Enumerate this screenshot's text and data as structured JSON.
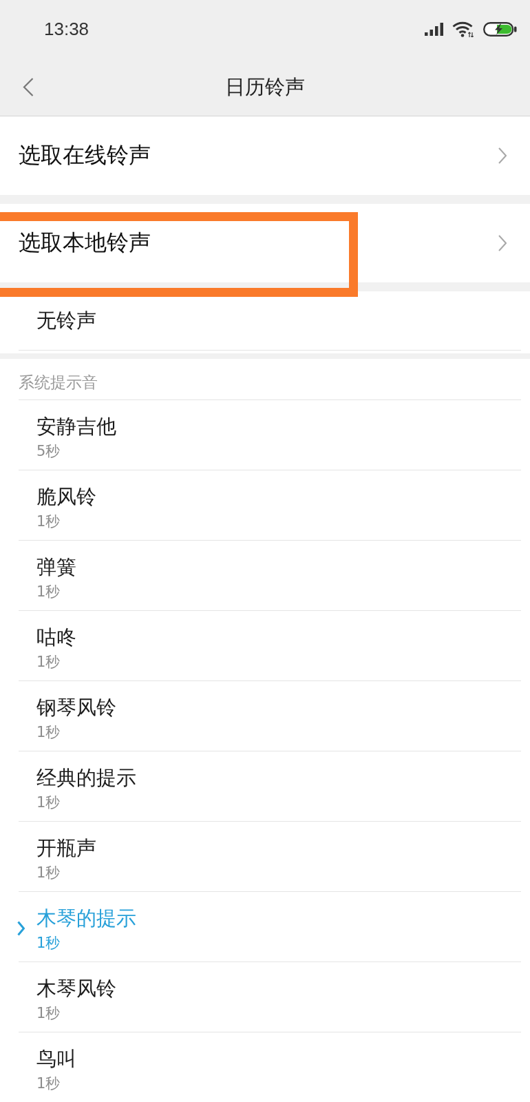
{
  "status_bar": {
    "time": "13:38"
  },
  "header": {
    "title": "日历铃声"
  },
  "links": [
    {
      "label": "选取在线铃声",
      "highlighted": false
    },
    {
      "label": "选取本地铃声",
      "highlighted": true
    }
  ],
  "no_ringtone": {
    "label": "无铃声",
    "selected": false
  },
  "system_sounds": {
    "title": "系统提示音",
    "items": [
      {
        "name": "安静吉他",
        "duration": "5秒",
        "selected": false
      },
      {
        "name": "脆风铃",
        "duration": "1秒",
        "selected": false
      },
      {
        "name": "弹簧",
        "duration": "1秒",
        "selected": false
      },
      {
        "name": "咕咚",
        "duration": "1秒",
        "selected": false
      },
      {
        "name": "钢琴风铃",
        "duration": "1秒",
        "selected": false
      },
      {
        "name": "经典的提示",
        "duration": "1秒",
        "selected": false
      },
      {
        "name": "开瓶声",
        "duration": "1秒",
        "selected": false
      },
      {
        "name": "木琴的提示",
        "duration": "1秒",
        "selected": true
      },
      {
        "name": "木琴风铃",
        "duration": "1秒",
        "selected": false
      },
      {
        "name": "鸟叫",
        "duration": "1秒",
        "selected": false
      }
    ]
  }
}
